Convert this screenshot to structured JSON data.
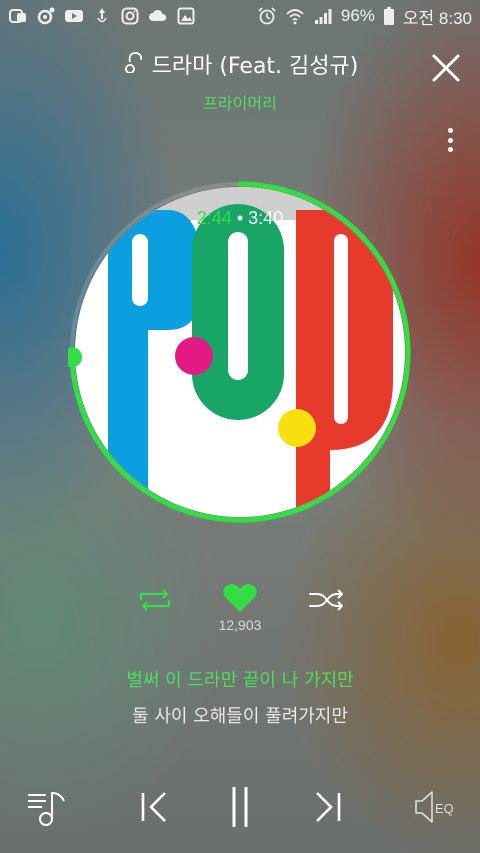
{
  "status_bar": {
    "left_icons": [
      "phone-app-icon",
      "music-app-icon",
      "youtube-icon",
      "voice-icon",
      "instagram-icon",
      "cloud-icon",
      "gallery-icon"
    ],
    "battery_percent": "96%",
    "clock": "오전 8:30"
  },
  "player": {
    "song_title": "드라마 (Feat. 김성규)",
    "artist": "프라이머리",
    "current_time": "2:44",
    "time_separator": "•",
    "total_time": "3:40",
    "progress_fraction": 0.745,
    "like_count": "12,903",
    "lyrics_current": "벌써 이 드라만 끝이 나 가지만",
    "lyrics_next": "둘 사이 오해들이 풀려가지만",
    "album_art_text": "POP"
  },
  "bottom_bar": {
    "eq_label": "EQ"
  },
  "colors": {
    "accent": "#33dd44",
    "text": "#ffffff"
  }
}
